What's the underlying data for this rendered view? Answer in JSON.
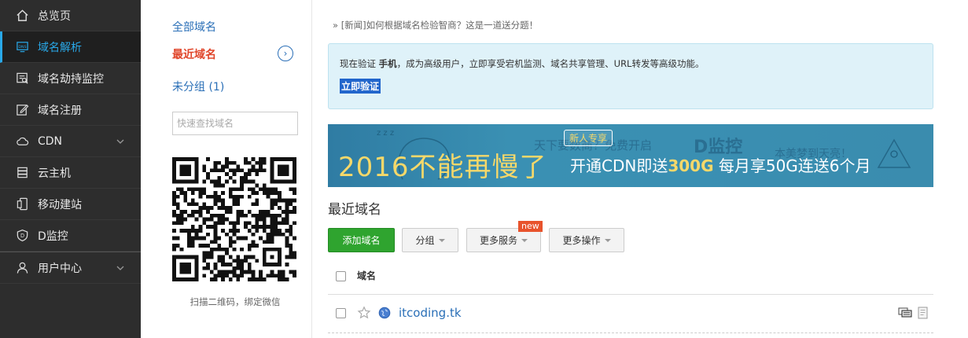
{
  "sidebar": {
    "items": [
      {
        "label": "总览页",
        "icon": "home-icon"
      },
      {
        "label": "域名解析",
        "icon": "dns-icon",
        "active": true
      },
      {
        "label": "域名劫持监控",
        "icon": "monitor-search-icon"
      },
      {
        "label": "域名注册",
        "icon": "edit-icon"
      },
      {
        "label": "CDN",
        "icon": "cloud-icon",
        "expandable": true
      },
      {
        "label": "云主机",
        "icon": "server-icon"
      },
      {
        "label": "移动建站",
        "icon": "mobile-icon"
      },
      {
        "label": "D监控",
        "icon": "shield-icon"
      },
      {
        "label": "用户中心",
        "icon": "user-icon",
        "expandable": true
      }
    ]
  },
  "groups": {
    "all": "全部域名",
    "recent": "最近域名",
    "ungrouped": "未分组 (1)"
  },
  "search": {
    "placeholder": "快速查找域名"
  },
  "qr": {
    "caption": "扫描二维码，绑定微信"
  },
  "news": "» [新闻]如何根据域名检验智商？这是一道送分题！",
  "notice": {
    "text_before": "现在验证 ",
    "text_bold": "手机",
    "text_after": "，成为高级用户，立即享受宕机监测、域名共享管理、URL转发等高级功能。",
    "verify_link": "立即验证"
  },
  "banner": {
    "big_text": "2016不能再慢了",
    "tag": "新人专享",
    "mid_text_before": "开通CDN即送",
    "mid_highlight": "300G",
    "mid_text_after": " 每月享50G连送6个月",
    "deco_text_1": "天下要数商？免费开启",
    "deco_text_2": "D监控",
    "deco_text_3": "本美梦到天亮！"
  },
  "section_title": "最近域名",
  "toolbar": {
    "add_label": "添加域名",
    "group_label": "分组",
    "more_services_label": "更多服务",
    "more_ops_label": "更多操作",
    "new_badge": "new"
  },
  "table": {
    "header": "域名",
    "rows": [
      {
        "domain": "itcoding.tk"
      }
    ]
  },
  "colors": {
    "sidebar_bg": "#2d2d2d",
    "active_accent": "#29a8e8",
    "link_blue": "#2a6fb7",
    "active_group_red": "#e0452a",
    "add_button_green": "#2fa42f",
    "notice_bg": "#dff2f9"
  }
}
